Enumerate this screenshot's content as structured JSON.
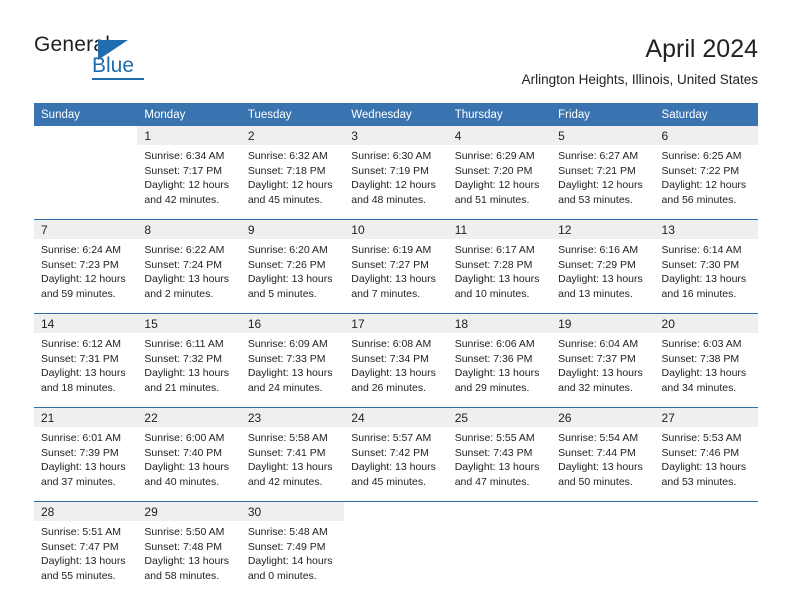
{
  "brand": {
    "name_part1": "General",
    "name_part2": "Blue",
    "primary_color": "#1f6cb0"
  },
  "header": {
    "title": "April 2024",
    "subtitle": "Arlington Heights, Illinois, United States"
  },
  "calendar": {
    "header_color": "#3a74b0",
    "daynum_background": "#efefef",
    "weekday_headers": [
      "Sunday",
      "Monday",
      "Tuesday",
      "Wednesday",
      "Thursday",
      "Friday",
      "Saturday"
    ],
    "weeks": [
      {
        "days": [
          {
            "day": "",
            "lines": []
          },
          {
            "day": "1",
            "lines": [
              "Sunrise: 6:34 AM",
              "Sunset: 7:17 PM",
              "Daylight: 12 hours",
              "and 42 minutes."
            ]
          },
          {
            "day": "2",
            "lines": [
              "Sunrise: 6:32 AM",
              "Sunset: 7:18 PM",
              "Daylight: 12 hours",
              "and 45 minutes."
            ]
          },
          {
            "day": "3",
            "lines": [
              "Sunrise: 6:30 AM",
              "Sunset: 7:19 PM",
              "Daylight: 12 hours",
              "and 48 minutes."
            ]
          },
          {
            "day": "4",
            "lines": [
              "Sunrise: 6:29 AM",
              "Sunset: 7:20 PM",
              "Daylight: 12 hours",
              "and 51 minutes."
            ]
          },
          {
            "day": "5",
            "lines": [
              "Sunrise: 6:27 AM",
              "Sunset: 7:21 PM",
              "Daylight: 12 hours",
              "and 53 minutes."
            ]
          },
          {
            "day": "6",
            "lines": [
              "Sunrise: 6:25 AM",
              "Sunset: 7:22 PM",
              "Daylight: 12 hours",
              "and 56 minutes."
            ]
          }
        ]
      },
      {
        "days": [
          {
            "day": "7",
            "lines": [
              "Sunrise: 6:24 AM",
              "Sunset: 7:23 PM",
              "Daylight: 12 hours",
              "and 59 minutes."
            ]
          },
          {
            "day": "8",
            "lines": [
              "Sunrise: 6:22 AM",
              "Sunset: 7:24 PM",
              "Daylight: 13 hours",
              "and 2 minutes."
            ]
          },
          {
            "day": "9",
            "lines": [
              "Sunrise: 6:20 AM",
              "Sunset: 7:26 PM",
              "Daylight: 13 hours",
              "and 5 minutes."
            ]
          },
          {
            "day": "10",
            "lines": [
              "Sunrise: 6:19 AM",
              "Sunset: 7:27 PM",
              "Daylight: 13 hours",
              "and 7 minutes."
            ]
          },
          {
            "day": "11",
            "lines": [
              "Sunrise: 6:17 AM",
              "Sunset: 7:28 PM",
              "Daylight: 13 hours",
              "and 10 minutes."
            ]
          },
          {
            "day": "12",
            "lines": [
              "Sunrise: 6:16 AM",
              "Sunset: 7:29 PM",
              "Daylight: 13 hours",
              "and 13 minutes."
            ]
          },
          {
            "day": "13",
            "lines": [
              "Sunrise: 6:14 AM",
              "Sunset: 7:30 PM",
              "Daylight: 13 hours",
              "and 16 minutes."
            ]
          }
        ]
      },
      {
        "days": [
          {
            "day": "14",
            "lines": [
              "Sunrise: 6:12 AM",
              "Sunset: 7:31 PM",
              "Daylight: 13 hours",
              "and 18 minutes."
            ]
          },
          {
            "day": "15",
            "lines": [
              "Sunrise: 6:11 AM",
              "Sunset: 7:32 PM",
              "Daylight: 13 hours",
              "and 21 minutes."
            ]
          },
          {
            "day": "16",
            "lines": [
              "Sunrise: 6:09 AM",
              "Sunset: 7:33 PM",
              "Daylight: 13 hours",
              "and 24 minutes."
            ]
          },
          {
            "day": "17",
            "lines": [
              "Sunrise: 6:08 AM",
              "Sunset: 7:34 PM",
              "Daylight: 13 hours",
              "and 26 minutes."
            ]
          },
          {
            "day": "18",
            "lines": [
              "Sunrise: 6:06 AM",
              "Sunset: 7:36 PM",
              "Daylight: 13 hours",
              "and 29 minutes."
            ]
          },
          {
            "day": "19",
            "lines": [
              "Sunrise: 6:04 AM",
              "Sunset: 7:37 PM",
              "Daylight: 13 hours",
              "and 32 minutes."
            ]
          },
          {
            "day": "20",
            "lines": [
              "Sunrise: 6:03 AM",
              "Sunset: 7:38 PM",
              "Daylight: 13 hours",
              "and 34 minutes."
            ]
          }
        ]
      },
      {
        "days": [
          {
            "day": "21",
            "lines": [
              "Sunrise: 6:01 AM",
              "Sunset: 7:39 PM",
              "Daylight: 13 hours",
              "and 37 minutes."
            ]
          },
          {
            "day": "22",
            "lines": [
              "Sunrise: 6:00 AM",
              "Sunset: 7:40 PM",
              "Daylight: 13 hours",
              "and 40 minutes."
            ]
          },
          {
            "day": "23",
            "lines": [
              "Sunrise: 5:58 AM",
              "Sunset: 7:41 PM",
              "Daylight: 13 hours",
              "and 42 minutes."
            ]
          },
          {
            "day": "24",
            "lines": [
              "Sunrise: 5:57 AM",
              "Sunset: 7:42 PM",
              "Daylight: 13 hours",
              "and 45 minutes."
            ]
          },
          {
            "day": "25",
            "lines": [
              "Sunrise: 5:55 AM",
              "Sunset: 7:43 PM",
              "Daylight: 13 hours",
              "and 47 minutes."
            ]
          },
          {
            "day": "26",
            "lines": [
              "Sunrise: 5:54 AM",
              "Sunset: 7:44 PM",
              "Daylight: 13 hours",
              "and 50 minutes."
            ]
          },
          {
            "day": "27",
            "lines": [
              "Sunrise: 5:53 AM",
              "Sunset: 7:46 PM",
              "Daylight: 13 hours",
              "and 53 minutes."
            ]
          }
        ]
      },
      {
        "days": [
          {
            "day": "28",
            "lines": [
              "Sunrise: 5:51 AM",
              "Sunset: 7:47 PM",
              "Daylight: 13 hours",
              "and 55 minutes."
            ]
          },
          {
            "day": "29",
            "lines": [
              "Sunrise: 5:50 AM",
              "Sunset: 7:48 PM",
              "Daylight: 13 hours",
              "and 58 minutes."
            ]
          },
          {
            "day": "30",
            "lines": [
              "Sunrise: 5:48 AM",
              "Sunset: 7:49 PM",
              "Daylight: 14 hours",
              "and 0 minutes."
            ]
          },
          {
            "day": "",
            "lines": []
          },
          {
            "day": "",
            "lines": []
          },
          {
            "day": "",
            "lines": []
          },
          {
            "day": "",
            "lines": []
          }
        ]
      }
    ]
  }
}
